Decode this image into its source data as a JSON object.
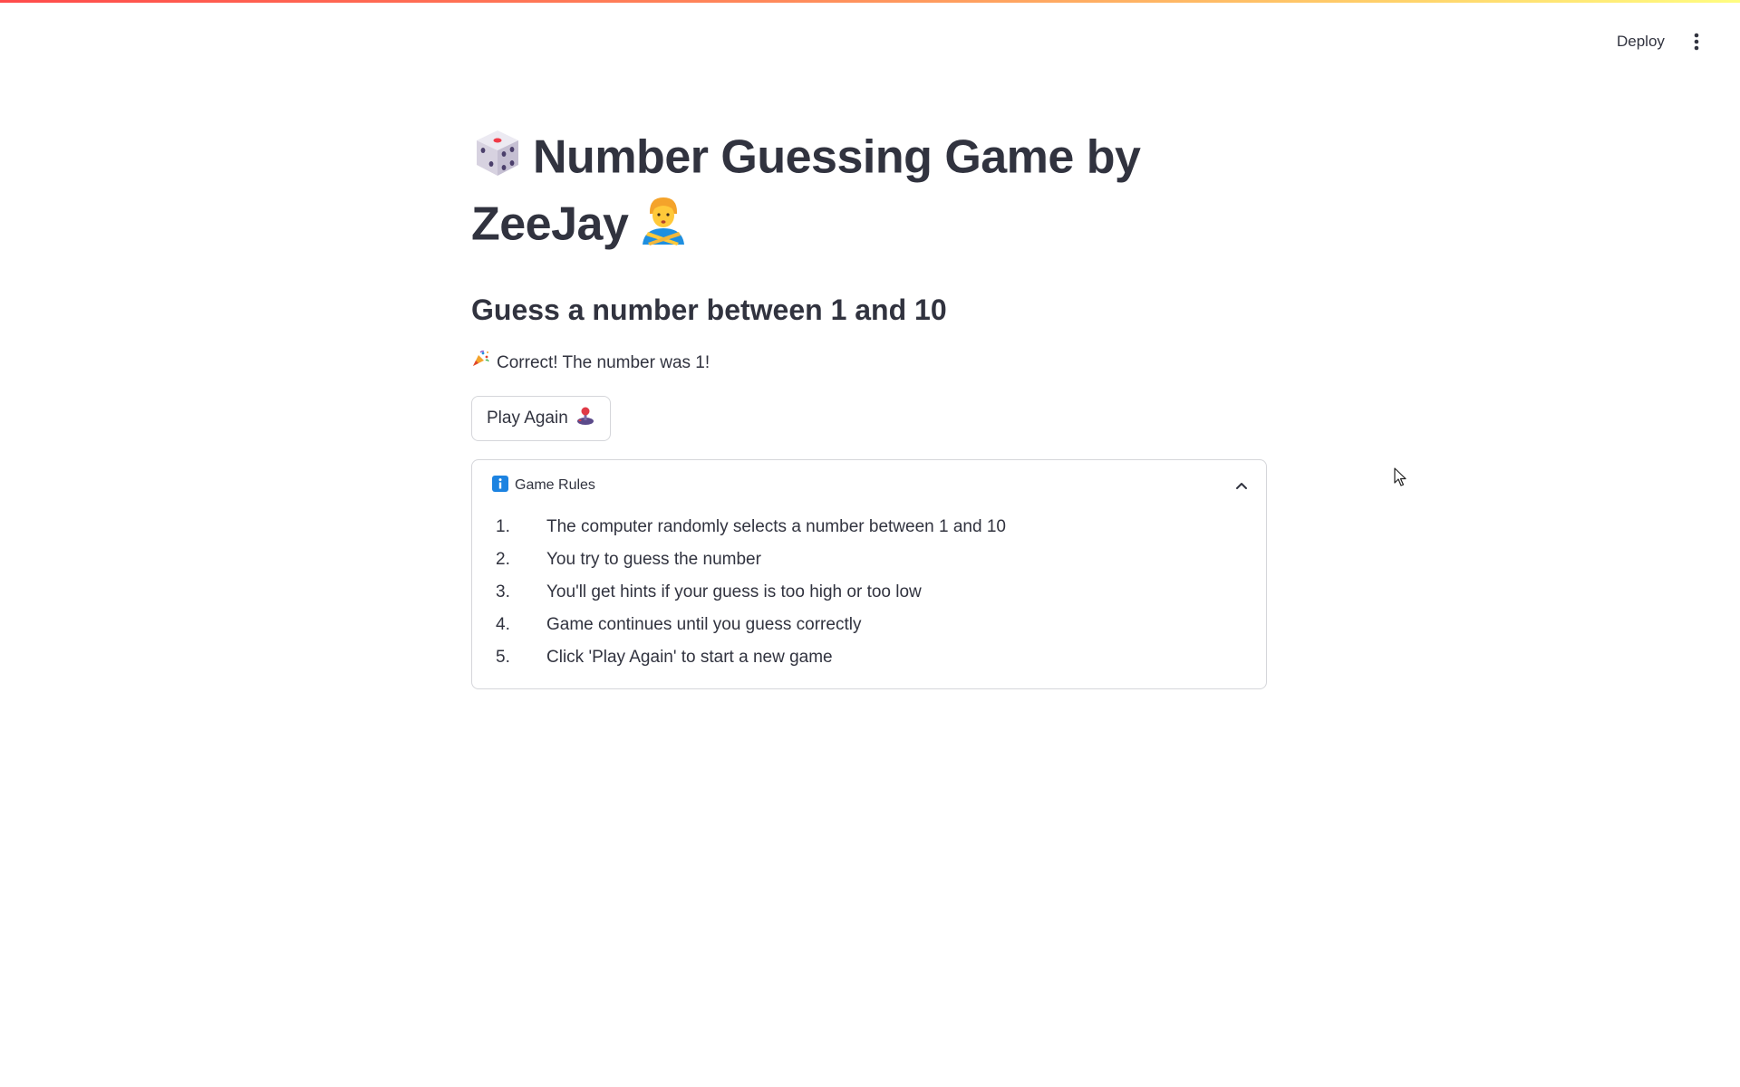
{
  "header": {
    "deploy_label": "Deploy",
    "menu_icon": "vertical-ellipsis-icon"
  },
  "main": {
    "title_part1": "Number Guessing Game by",
    "title_part2": "ZeeJay",
    "title_icon_left": "dice-icon",
    "title_icon_right": "person-gesturing-no-icon",
    "subheader": "Guess a number between 1 and 10",
    "result_icon": "party-popper-icon",
    "result_text": "Correct! The number was 1!",
    "play_again_label": "Play Again",
    "play_again_icon": "joystick-icon"
  },
  "rules": {
    "title": "Game Rules",
    "icon": "information-icon",
    "expanded": true,
    "items": [
      {
        "num": "1.",
        "text": "The computer randomly selects a number between 1 and 10"
      },
      {
        "num": "2.",
        "text": "You try to guess the number"
      },
      {
        "num": "3.",
        "text": "You'll get hints if your guess is too high or too low"
      },
      {
        "num": "4.",
        "text": "Game continues until you guess correctly"
      },
      {
        "num": "5.",
        "text": "Click 'Play Again' to start a new game"
      }
    ]
  },
  "colors": {
    "text": "#31333f",
    "border": "#d5d6da",
    "accent_red": "#ff4b4b",
    "info_blue": "#1c83e1"
  }
}
